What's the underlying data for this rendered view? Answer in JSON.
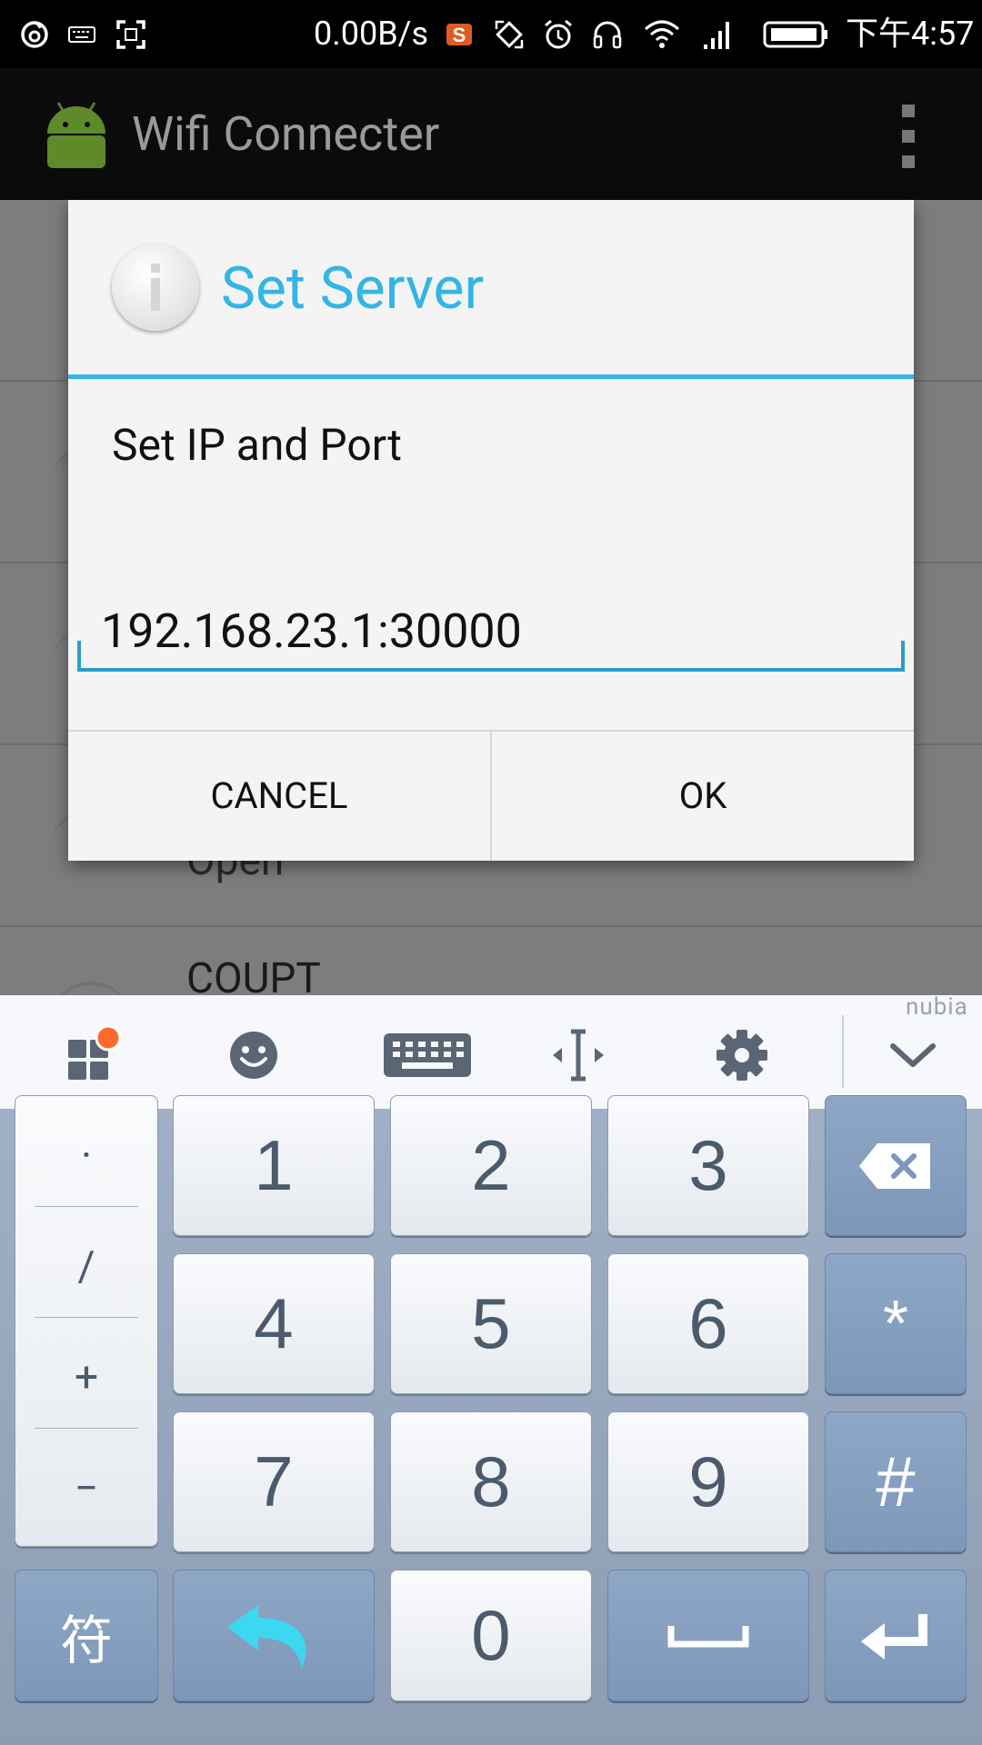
{
  "status_bar": {
    "net_speed": "0.00B/s",
    "time": "下午4:57",
    "icons": [
      "netease-music-icon",
      "keyboard-icon",
      "screenshot-icon",
      "sogou-icon",
      "rotate-icon",
      "alarm-icon",
      "headset-icon",
      "wifi-icon",
      "signal-icon",
      "battery-icon"
    ]
  },
  "app": {
    "title": "Wifi Connecter",
    "icons": [
      "android-icon",
      "overflow-menu-icon"
    ]
  },
  "background_list": {
    "items": [
      {
        "subtitle": "Open"
      },
      {
        "title": "COUPT"
      }
    ]
  },
  "dialog": {
    "title": "Set Server",
    "icon": "info-icon",
    "message": "Set IP and Port",
    "input_value": "192.168.23.1:30000",
    "cancel_label": "CANCEL",
    "ok_label": "OK",
    "accent_color": "#33b5e5"
  },
  "keyboard": {
    "brand": "nubia",
    "toolbar_icons": [
      "apps-grid-icon",
      "emoji-icon",
      "keyboard-icon",
      "cursor-move-icon",
      "settings-gear-icon",
      "collapse-chevron-icon"
    ],
    "symbols": [
      "·",
      "/",
      "+",
      "−"
    ],
    "digits": [
      "1",
      "2",
      "3",
      "4",
      "5",
      "6",
      "7",
      "8",
      "9",
      "0"
    ],
    "star": "*",
    "hash": "#",
    "fu_label": "符",
    "icons": [
      "backspace-icon",
      "undo-icon",
      "space-icon",
      "enter-icon"
    ]
  }
}
